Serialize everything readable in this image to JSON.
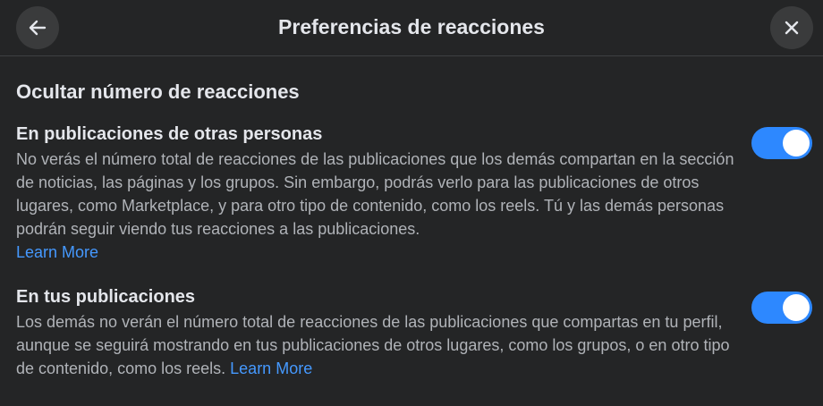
{
  "header": {
    "title": "Preferencias de reacciones",
    "back_icon": "arrow-left-icon",
    "close_icon": "close-icon"
  },
  "section": {
    "title": "Ocultar número de reacciones"
  },
  "options": [
    {
      "title": "En publicaciones de otras personas",
      "description": "No verás el número total de reacciones de las publicaciones que los demás compartan en la sección de noticias, las páginas y los grupos. Sin embargo, podrás verlo para las publicaciones de otros lugares, como Marketplace, y para otro tipo de contenido, como los reels. Tú y las demás personas podrán seguir viendo tus reacciones a las publicaciones.",
      "link": "Learn More",
      "enabled": true
    },
    {
      "title": "En tus publicaciones",
      "description": "Los demás no verán el número total de reacciones de las publicaciones que compartas en tu perfil, aunque se seguirá mostrando en tus publicaciones de otros lugares, como los grupos, o en otro tipo de contenido, como los reels.",
      "link": "Learn More",
      "enabled": true
    }
  ],
  "colors": {
    "background": "#242526",
    "toggle_on": "#2d88ff",
    "link": "#4599ff"
  }
}
